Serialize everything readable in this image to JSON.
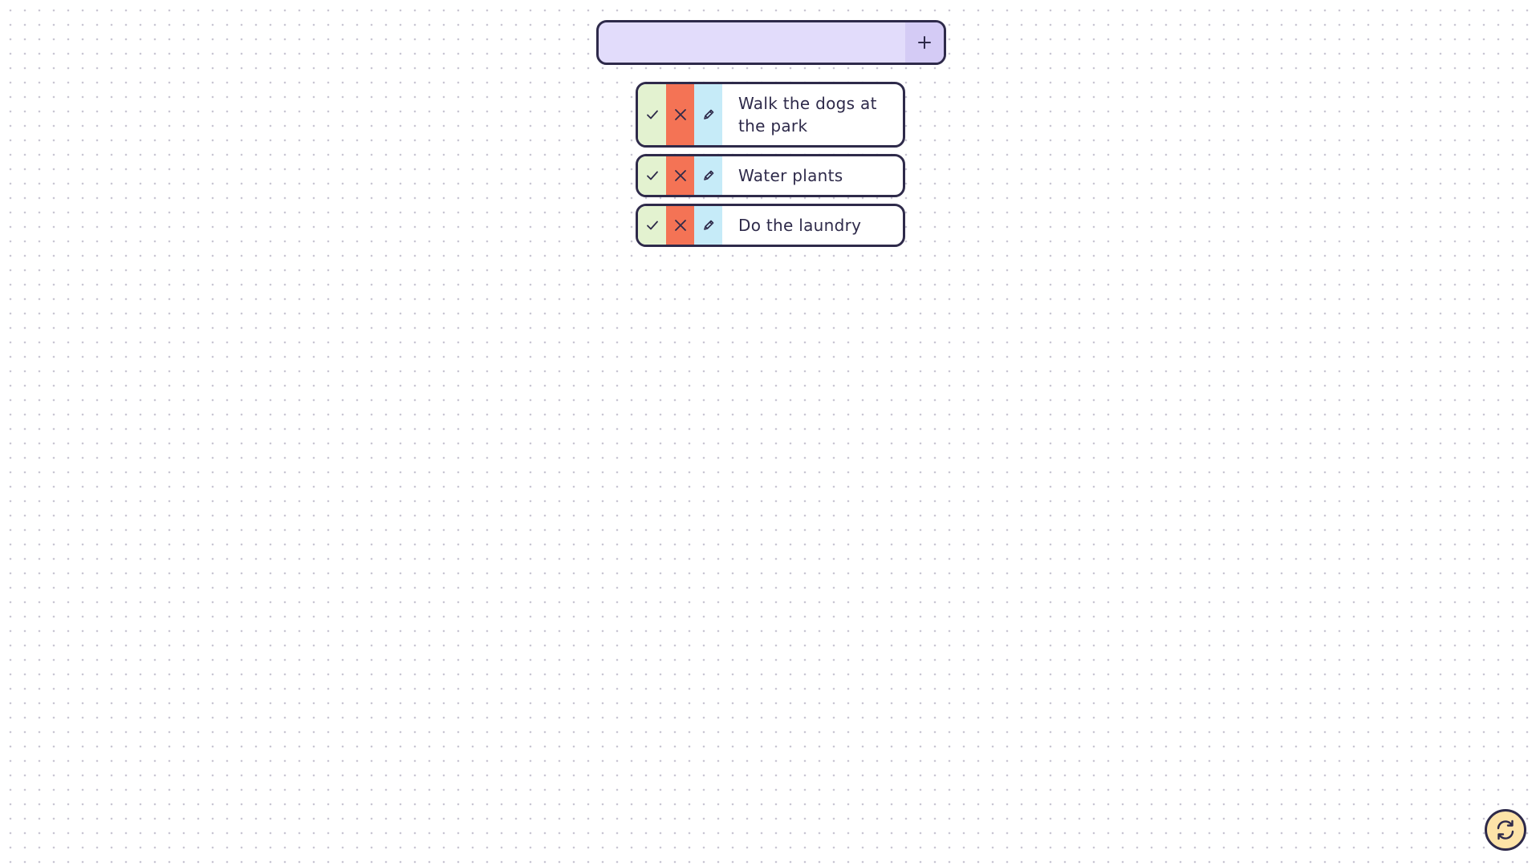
{
  "add_bar": {
    "input_value": "",
    "placeholder": "",
    "add_icon": "plus-icon"
  },
  "todos": [
    {
      "text": "Walk the dogs at the park"
    },
    {
      "text": "Water plants"
    },
    {
      "text": "Do the laundry"
    }
  ],
  "item_actions": {
    "done_icon": "check-icon",
    "delete_icon": "close-icon",
    "edit_icon": "pencil-icon"
  },
  "refresh_icon": "refresh-icon",
  "colors": {
    "outline": "#2e2a4a",
    "input_bg": "#e2dcfb",
    "add_button_bg": "#d4cbf5",
    "done_bg": "#e3f2d0",
    "delete_bg": "#f47355",
    "edit_bg": "#c6ebf8",
    "refresh_bg": "#fde3a8"
  }
}
